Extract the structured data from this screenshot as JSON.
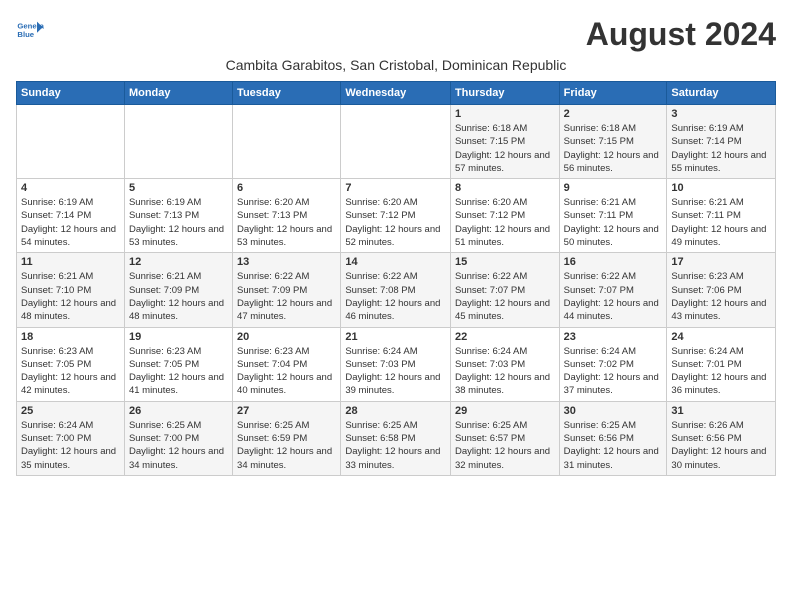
{
  "header": {
    "logo_line1": "General",
    "logo_line2": "Blue",
    "month_year": "August 2024",
    "location": "Cambita Garabitos, San Cristobal, Dominican Republic"
  },
  "days_of_week": [
    "Sunday",
    "Monday",
    "Tuesday",
    "Wednesday",
    "Thursday",
    "Friday",
    "Saturday"
  ],
  "weeks": [
    [
      {
        "day": "",
        "info": ""
      },
      {
        "day": "",
        "info": ""
      },
      {
        "day": "",
        "info": ""
      },
      {
        "day": "",
        "info": ""
      },
      {
        "day": "1",
        "info": "Sunrise: 6:18 AM\nSunset: 7:15 PM\nDaylight: 12 hours and 57 minutes."
      },
      {
        "day": "2",
        "info": "Sunrise: 6:18 AM\nSunset: 7:15 PM\nDaylight: 12 hours and 56 minutes."
      },
      {
        "day": "3",
        "info": "Sunrise: 6:19 AM\nSunset: 7:14 PM\nDaylight: 12 hours and 55 minutes."
      }
    ],
    [
      {
        "day": "4",
        "info": "Sunrise: 6:19 AM\nSunset: 7:14 PM\nDaylight: 12 hours and 54 minutes."
      },
      {
        "day": "5",
        "info": "Sunrise: 6:19 AM\nSunset: 7:13 PM\nDaylight: 12 hours and 53 minutes."
      },
      {
        "day": "6",
        "info": "Sunrise: 6:20 AM\nSunset: 7:13 PM\nDaylight: 12 hours and 53 minutes."
      },
      {
        "day": "7",
        "info": "Sunrise: 6:20 AM\nSunset: 7:12 PM\nDaylight: 12 hours and 52 minutes."
      },
      {
        "day": "8",
        "info": "Sunrise: 6:20 AM\nSunset: 7:12 PM\nDaylight: 12 hours and 51 minutes."
      },
      {
        "day": "9",
        "info": "Sunrise: 6:21 AM\nSunset: 7:11 PM\nDaylight: 12 hours and 50 minutes."
      },
      {
        "day": "10",
        "info": "Sunrise: 6:21 AM\nSunset: 7:11 PM\nDaylight: 12 hours and 49 minutes."
      }
    ],
    [
      {
        "day": "11",
        "info": "Sunrise: 6:21 AM\nSunset: 7:10 PM\nDaylight: 12 hours and 48 minutes."
      },
      {
        "day": "12",
        "info": "Sunrise: 6:21 AM\nSunset: 7:09 PM\nDaylight: 12 hours and 48 minutes."
      },
      {
        "day": "13",
        "info": "Sunrise: 6:22 AM\nSunset: 7:09 PM\nDaylight: 12 hours and 47 minutes."
      },
      {
        "day": "14",
        "info": "Sunrise: 6:22 AM\nSunset: 7:08 PM\nDaylight: 12 hours and 46 minutes."
      },
      {
        "day": "15",
        "info": "Sunrise: 6:22 AM\nSunset: 7:07 PM\nDaylight: 12 hours and 45 minutes."
      },
      {
        "day": "16",
        "info": "Sunrise: 6:22 AM\nSunset: 7:07 PM\nDaylight: 12 hours and 44 minutes."
      },
      {
        "day": "17",
        "info": "Sunrise: 6:23 AM\nSunset: 7:06 PM\nDaylight: 12 hours and 43 minutes."
      }
    ],
    [
      {
        "day": "18",
        "info": "Sunrise: 6:23 AM\nSunset: 7:05 PM\nDaylight: 12 hours and 42 minutes."
      },
      {
        "day": "19",
        "info": "Sunrise: 6:23 AM\nSunset: 7:05 PM\nDaylight: 12 hours and 41 minutes."
      },
      {
        "day": "20",
        "info": "Sunrise: 6:23 AM\nSunset: 7:04 PM\nDaylight: 12 hours and 40 minutes."
      },
      {
        "day": "21",
        "info": "Sunrise: 6:24 AM\nSunset: 7:03 PM\nDaylight: 12 hours and 39 minutes."
      },
      {
        "day": "22",
        "info": "Sunrise: 6:24 AM\nSunset: 7:03 PM\nDaylight: 12 hours and 38 minutes."
      },
      {
        "day": "23",
        "info": "Sunrise: 6:24 AM\nSunset: 7:02 PM\nDaylight: 12 hours and 37 minutes."
      },
      {
        "day": "24",
        "info": "Sunrise: 6:24 AM\nSunset: 7:01 PM\nDaylight: 12 hours and 36 minutes."
      }
    ],
    [
      {
        "day": "25",
        "info": "Sunrise: 6:24 AM\nSunset: 7:00 PM\nDaylight: 12 hours and 35 minutes."
      },
      {
        "day": "26",
        "info": "Sunrise: 6:25 AM\nSunset: 7:00 PM\nDaylight: 12 hours and 34 minutes."
      },
      {
        "day": "27",
        "info": "Sunrise: 6:25 AM\nSunset: 6:59 PM\nDaylight: 12 hours and 34 minutes."
      },
      {
        "day": "28",
        "info": "Sunrise: 6:25 AM\nSunset: 6:58 PM\nDaylight: 12 hours and 33 minutes."
      },
      {
        "day": "29",
        "info": "Sunrise: 6:25 AM\nSunset: 6:57 PM\nDaylight: 12 hours and 32 minutes."
      },
      {
        "day": "30",
        "info": "Sunrise: 6:25 AM\nSunset: 6:56 PM\nDaylight: 12 hours and 31 minutes."
      },
      {
        "day": "31",
        "info": "Sunrise: 6:26 AM\nSunset: 6:56 PM\nDaylight: 12 hours and 30 minutes."
      }
    ]
  ]
}
